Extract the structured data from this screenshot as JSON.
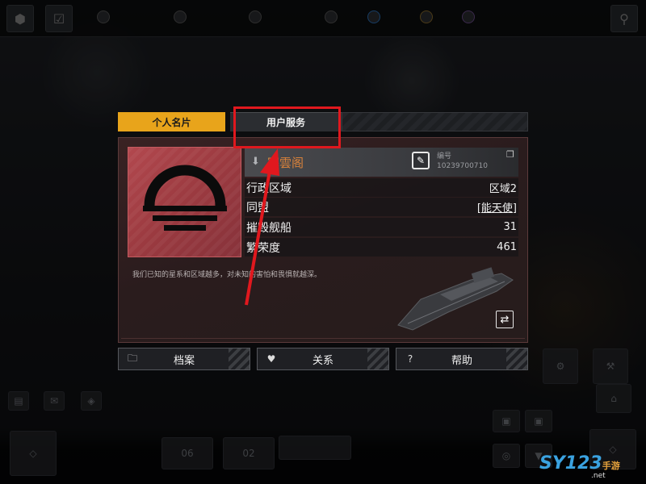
{
  "tabs": {
    "card_label": "个人名片",
    "service_label": "用户服务"
  },
  "profile": {
    "name": "寒雲阁",
    "id_label": "编号",
    "id_value": "10239700710",
    "rows": [
      {
        "key": "行政区域",
        "value": "区域2"
      },
      {
        "key": "同盟",
        "value": "[能天使]"
      },
      {
        "key": "摧毁舰船",
        "value": "31"
      },
      {
        "key": "繁荣度",
        "value": "461"
      }
    ],
    "quote": "我们已知的星系和区域越多，对未知的害怕和畏惧就越深。"
  },
  "actions": {
    "archive_label": "档案",
    "relation_label": "关系",
    "help_label": "帮助"
  },
  "hud": {
    "bottom_left_values": [
      "06",
      "02"
    ]
  },
  "watermark": {
    "brand": "SY123",
    "suffix": "手游",
    "domain": ".net"
  },
  "colors": {
    "accent": "#e8a41b",
    "highlight": "#e0181e",
    "emblem": "#a8444a",
    "name": "#d7813b"
  },
  "icons": {
    "download": "download-icon",
    "edit": "edit-icon",
    "copy": "copy-icon",
    "swap": "swap-icon",
    "folder": "folder-icon",
    "relation": "relation-icon",
    "help": "help-icon"
  }
}
